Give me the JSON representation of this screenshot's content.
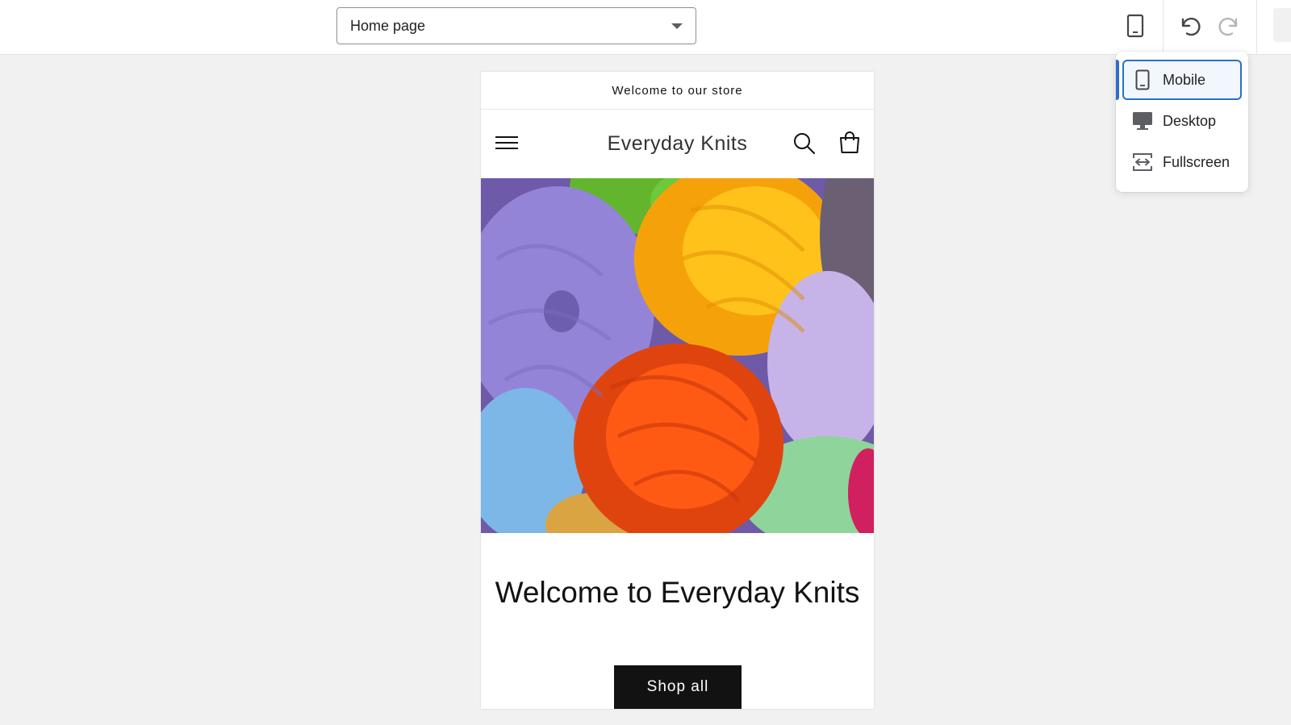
{
  "toolbar": {
    "page_select_value": "Home page",
    "device_icon": "mobile-icon",
    "undo_icon": "undo-icon",
    "redo_icon": "redo-icon"
  },
  "device_menu": {
    "items": [
      {
        "label": "Mobile",
        "icon": "mobile-icon",
        "active": true
      },
      {
        "label": "Desktop",
        "icon": "desktop-icon",
        "active": false
      },
      {
        "label": "Fullscreen",
        "icon": "fullscreen-icon",
        "active": false
      }
    ]
  },
  "preview": {
    "announcement": "Welcome to our store",
    "brand": "Everyday Knits",
    "hero_title": "Welcome to Everyday Knits",
    "cta_label": "Shop all",
    "hero_image_icon": "yarn-balls-image"
  },
  "colors": {
    "accent": "#2c6ecb",
    "button_bg": "#121212",
    "canvas_bg": "#f1f1f1"
  }
}
